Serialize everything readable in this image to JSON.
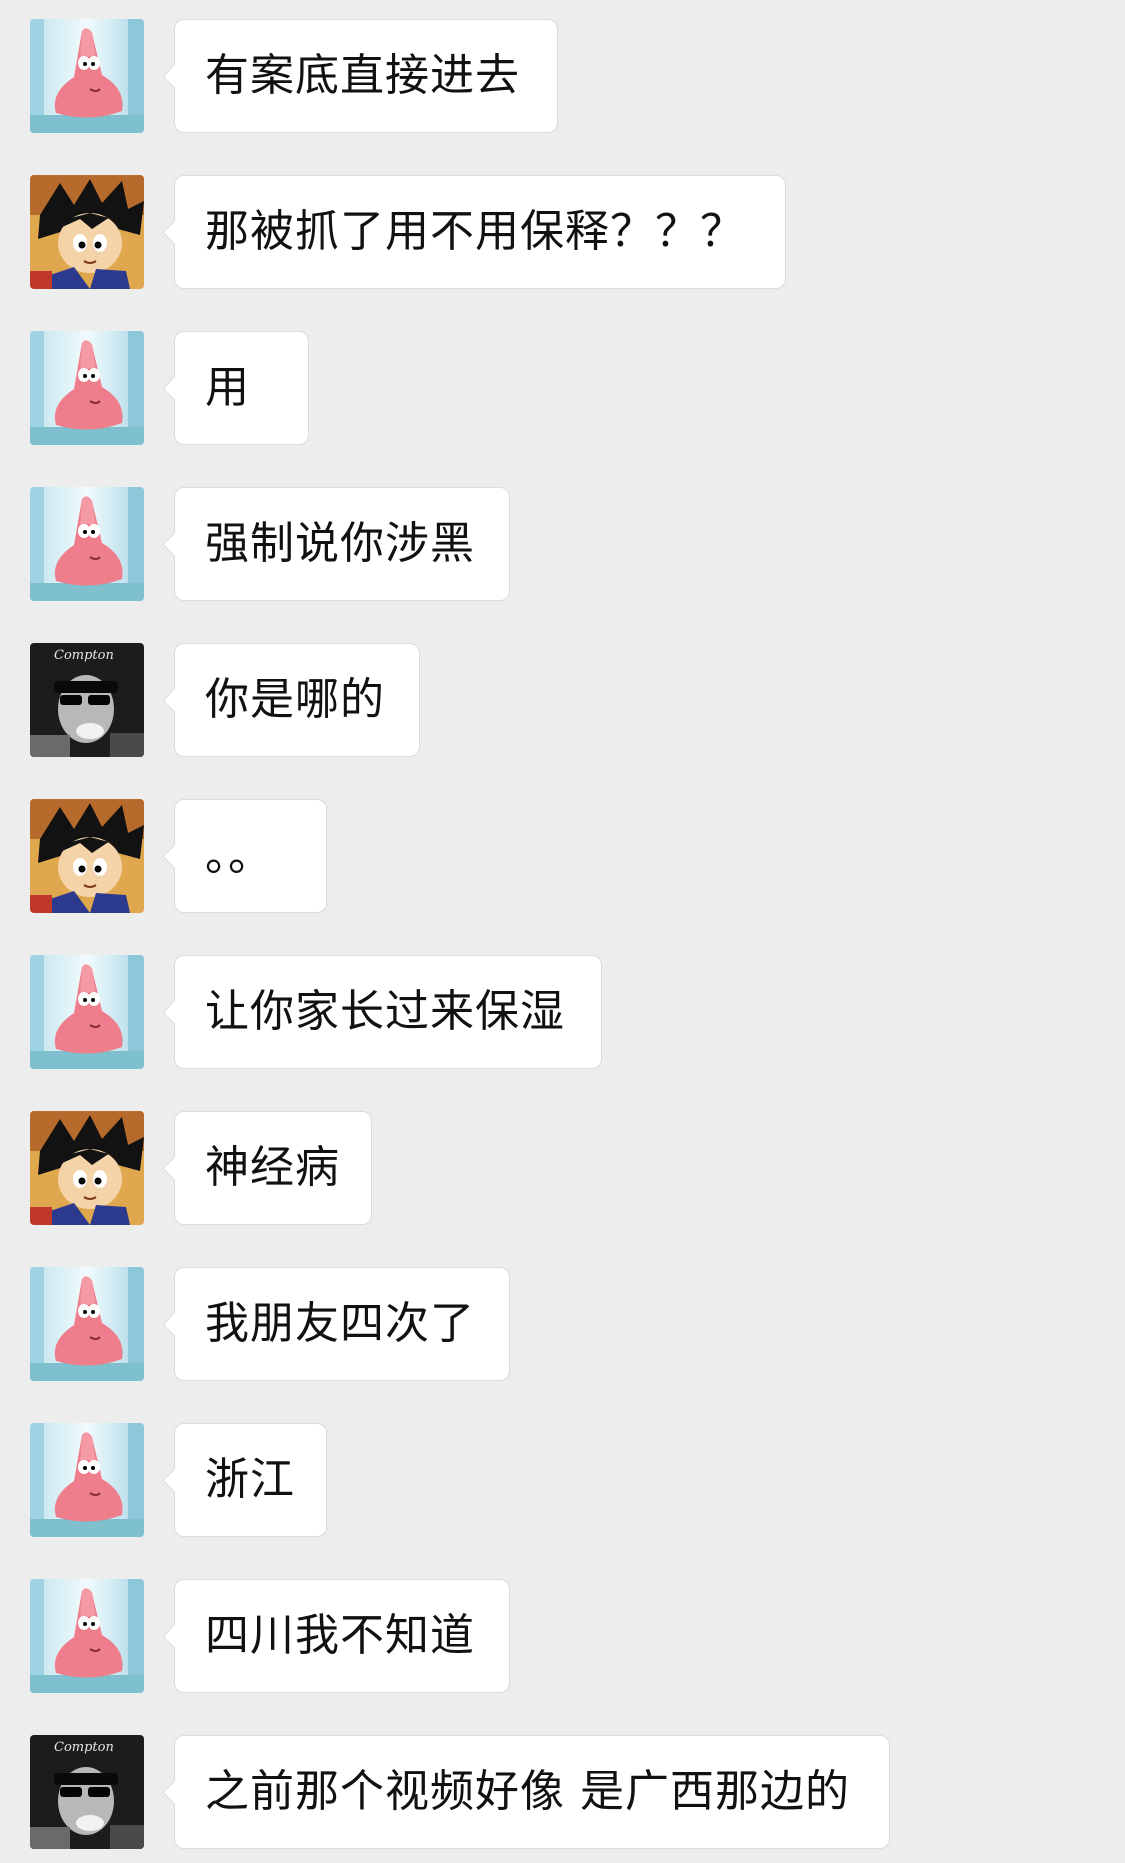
{
  "colors": {
    "background": "#ededed",
    "bubble": "#ffffff",
    "bubble_border": "#dcdcdc",
    "text": "#111111"
  },
  "messages": [
    {
      "avatar": "patrick-star-avatar",
      "text": "有案底直接进去"
    },
    {
      "avatar": "kid-goku-avatar",
      "text": "那被抓了用不用保释？？？"
    },
    {
      "avatar": "patrick-star-avatar",
      "text": "用"
    },
    {
      "avatar": "patrick-star-avatar",
      "text": "强制说你涉黑"
    },
    {
      "avatar": "compton-avatar",
      "text": "你是哪的"
    },
    {
      "avatar": "kid-goku-avatar",
      "text": "。。"
    },
    {
      "avatar": "patrick-star-avatar",
      "text": "让你家长过来保湿"
    },
    {
      "avatar": "kid-goku-avatar",
      "text": "神经病"
    },
    {
      "avatar": "patrick-star-avatar",
      "text": "我朋友四次了"
    },
    {
      "avatar": "patrick-star-avatar",
      "text": "浙江"
    },
    {
      "avatar": "patrick-star-avatar",
      "text": "四川我不知道"
    },
    {
      "avatar": "compton-avatar",
      "text": "之前那个视频好像 是广西那边的"
    }
  ],
  "avatar_logo_text": "Compton"
}
